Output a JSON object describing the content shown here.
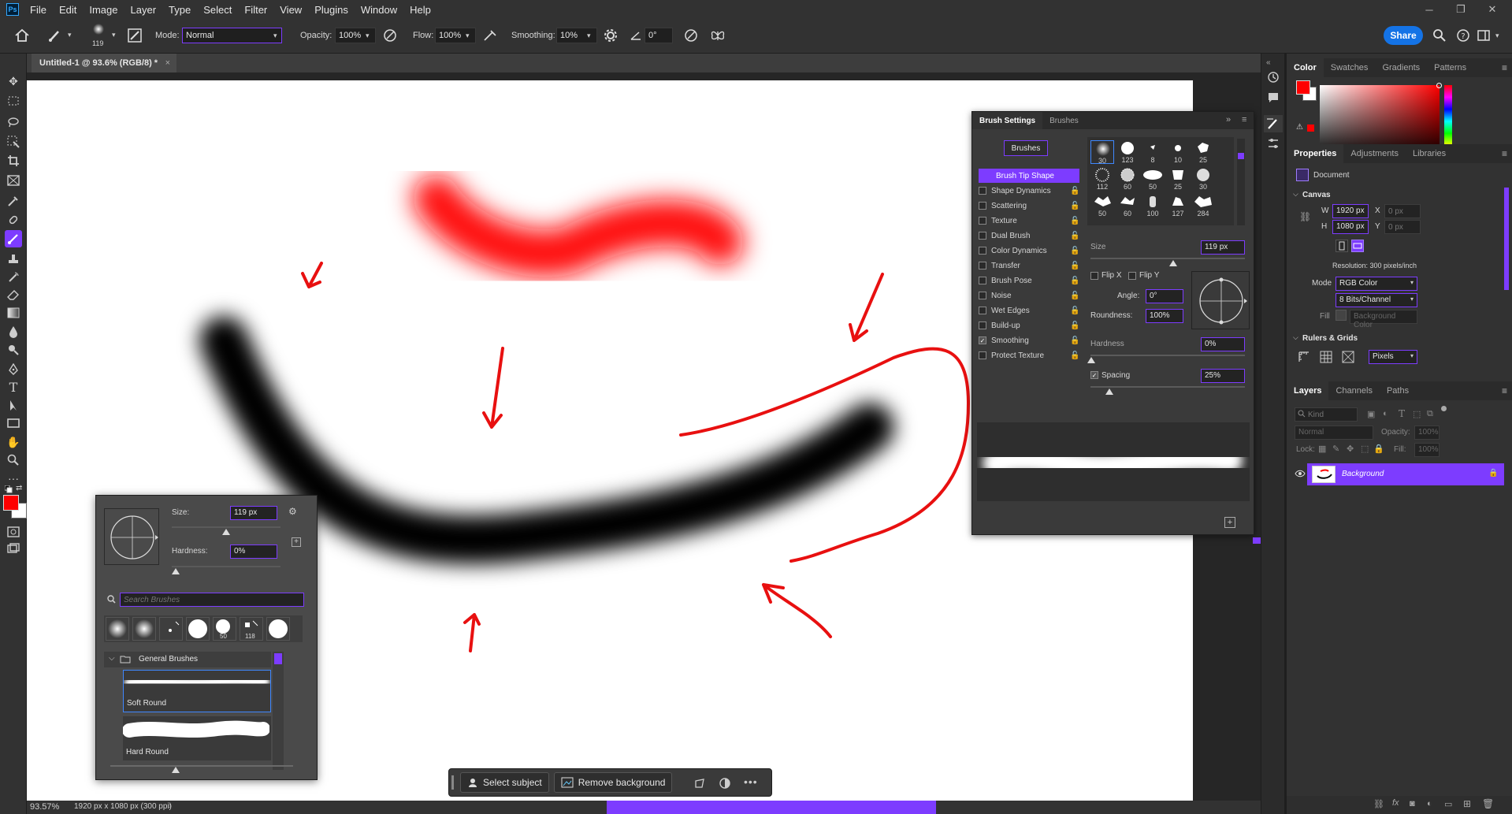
{
  "menu": {
    "app_badge": "Ps",
    "items": [
      "File",
      "Edit",
      "Image",
      "Layer",
      "Type",
      "Select",
      "Filter",
      "View",
      "Plugins",
      "Window",
      "Help"
    ]
  },
  "options": {
    "brush_size": "119",
    "mode_label": "Mode:",
    "mode_value": "Normal",
    "opacity_label": "Opacity:",
    "opacity_value": "100%",
    "flow_label": "Flow:",
    "flow_value": "100%",
    "smoothing_label": "Smoothing:",
    "smoothing_value": "10%",
    "angle_value": "0°",
    "share_label": "Share"
  },
  "document": {
    "tab_title": "Untitled-1 @ 93.6% (RGB/8) *",
    "zoom": "93.57%",
    "doc_info": "1920 px x 1080 px (300 ppi)"
  },
  "brush_settings": {
    "tabs": [
      "Brush Settings",
      "Brushes"
    ],
    "brushes_button": "Brushes",
    "items": [
      {
        "label": "Brush Tip Shape",
        "checked": null,
        "active": true
      },
      {
        "label": "Shape Dynamics",
        "checked": false
      },
      {
        "label": "Scattering",
        "checked": false
      },
      {
        "label": "Texture",
        "checked": false
      },
      {
        "label": "Dual Brush",
        "checked": false
      },
      {
        "label": "Color Dynamics",
        "checked": false
      },
      {
        "label": "Transfer",
        "checked": false
      },
      {
        "label": "Brush Pose",
        "checked": false
      },
      {
        "label": "Noise",
        "checked": false
      },
      {
        "label": "Wet Edges",
        "checked": false
      },
      {
        "label": "Build-up",
        "checked": false
      },
      {
        "label": "Smoothing",
        "checked": true
      },
      {
        "label": "Protect Texture",
        "checked": false
      }
    ],
    "tips": [
      "30",
      "123",
      "8",
      "10",
      "25",
      "112",
      "60",
      "50",
      "25",
      "30",
      "50",
      "60",
      "100",
      "127",
      "284"
    ],
    "size_label": "Size",
    "size_value": "119 px",
    "flipx_label": "Flip X",
    "flipy_label": "Flip Y",
    "angle_label": "Angle:",
    "angle_value": "0°",
    "roundness_label": "Roundness:",
    "roundness_value": "100%",
    "hardness_label": "Hardness",
    "hardness_value": "0%",
    "spacing_label": "Spacing",
    "spacing_value": "25%",
    "spacing_checked": true
  },
  "brush_picker": {
    "size_label": "Size:",
    "size_value": "119 px",
    "hardness_label": "Hardness:",
    "hardness_value": "0%",
    "search_placeholder": "Search Brushes",
    "recent": [
      "",
      "",
      "",
      "",
      "50",
      "118",
      ""
    ],
    "folder": "General Brushes",
    "presets": [
      "Soft Round",
      "Hard Round"
    ]
  },
  "taskbar": {
    "select_subject": "Select subject",
    "remove_background": "Remove background"
  },
  "color_panel": {
    "tabs": [
      "Color",
      "Swatches",
      "Gradients",
      "Patterns"
    ],
    "foreground": "#ff0000",
    "background": "#ffffff"
  },
  "properties": {
    "tabs": [
      "Properties",
      "Adjustments",
      "Libraries"
    ],
    "doc_label": "Document",
    "canvas_header": "Canvas",
    "w_label": "W",
    "w_value": "1920 px",
    "h_label": "H",
    "h_value": "1080 px",
    "x_label": "X",
    "x_placeholder": "0 px",
    "y_label": "Y",
    "y_placeholder": "0 px",
    "resolution": "Resolution: 300 pixels/inch",
    "mode_label": "Mode",
    "mode_value": "RGB Color",
    "depth_value": "8 Bits/Channel",
    "fill_label": "Fill",
    "fill_value": "Background Color",
    "rulers_header": "Rulers & Grids",
    "units_value": "Pixels"
  },
  "layers": {
    "tabs": [
      "Layers",
      "Channels",
      "Paths"
    ],
    "kind_placeholder": "Kind",
    "blend_value": "Normal",
    "opacity_label": "Opacity:",
    "opacity_value": "100%",
    "lock_label": "Lock:",
    "fill_label": "Fill:",
    "fill_value": "100%",
    "layer_name": "Background"
  },
  "colors": {
    "accent": "#7d3cff",
    "share": "#1473e6",
    "annotation": "#e81010"
  }
}
